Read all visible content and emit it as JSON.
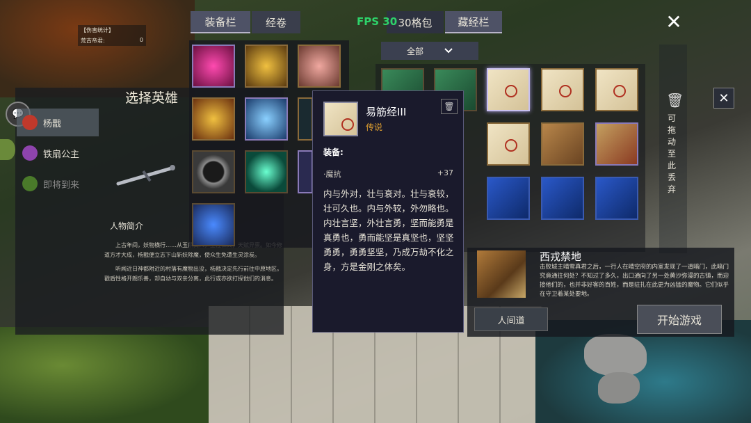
{
  "damage_stats": {
    "header": "【伤害统计】",
    "row_name": "荒古帝君:",
    "row_value": "0"
  },
  "hero_select": {
    "title": "选择英雄",
    "heroes": [
      {
        "name": "杨戬",
        "active": true,
        "color": "#c0392b"
      },
      {
        "name": "铁扇公主",
        "active": false,
        "color": "#8e44ad"
      },
      {
        "name": "即将到来",
        "active": false,
        "color": "#4a7a2a"
      }
    ],
    "bio_title": "人物简介",
    "bio_paragraphs": [
      "上古年间，妖物横行……从玉鼎真人，生性仁义，天赋异禀。如今修道方才大成，杨戬便立志下山斩妖除魔，使众生免遭生灵涂炭。",
      "听闻近日神都附近的村落有魔物出没，杨戬决定先行前往中原地区。戳盾性格开朗乐善，却自幼与双亲分离，此行或亦欲打探他们的消息。"
    ]
  },
  "hud": {
    "fps": "FPS 30",
    "close": "✕"
  },
  "bag": {
    "tabs": [
      {
        "label": "装备栏",
        "active": true
      },
      {
        "label": "经卷",
        "active": false
      },
      {
        "label": "30格包",
        "active": false
      },
      {
        "label": "藏经栏",
        "active": true
      }
    ],
    "filter": "全部",
    "discard_label": "可拖动至此丢弃"
  },
  "tooltip": {
    "name": "易筋经III",
    "grade": "传说",
    "grade_color": "#e0a030",
    "equip_header": "装备:",
    "stat_name": "·魔抗",
    "stat_value": "+37",
    "description": "内与外对，壮与衰对。壮与衰较，壮可久也。内与外较，外勿略也。内壮言坚，外壮言勇，坚而能勇是真勇也，勇而能坚是真坚也，坚坚勇勇，勇勇坚坚，乃成万劫不化之身，方是金刚之体矣。"
  },
  "map_select": {
    "name": "西戎禁地",
    "description": "击败城主晴雪真君之后，一行人在晴空府的内室发现了一道暗门，此暗门究竟通往何处？不知过了多久，出口通向了另一处黄沙弥漫的古镇，而迎接他们的，也并非好客的百姓，而是驻扎在此更为凶猛的魔物。它们似乎在守卫着某处要地。",
    "mode_label": "人间道",
    "start_label": "开始游戏"
  }
}
